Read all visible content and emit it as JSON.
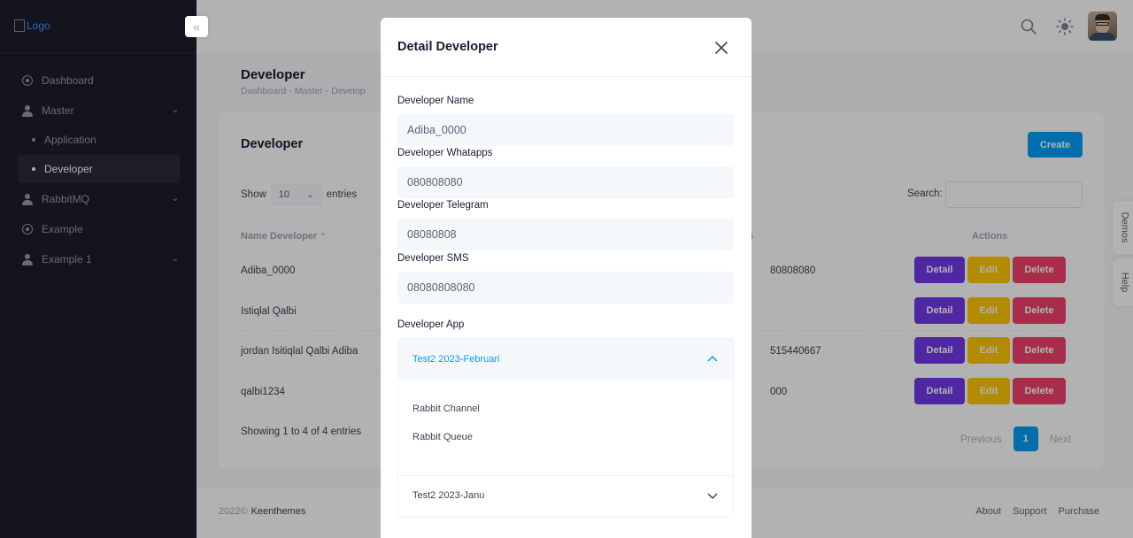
{
  "sidebar": {
    "logo_alt": "Logo",
    "items": [
      {
        "label": "Dashboard",
        "icon": "circle-dot-icon"
      },
      {
        "label": "Master",
        "icon": "user-icon"
      },
      {
        "label": "Application"
      },
      {
        "label": "Developer",
        "active": true
      },
      {
        "label": "RabbitMQ",
        "icon": "user-icon"
      },
      {
        "label": "Example",
        "icon": "circle-dot-icon"
      },
      {
        "label": "Example 1",
        "icon": "user-icon"
      }
    ]
  },
  "page": {
    "title": "Developer",
    "breadcrumb": "Dashboard - Master - Develop"
  },
  "card": {
    "title": "Developer",
    "create_label": "Create",
    "show_label": "Show",
    "page_size": "10",
    "entries_label": "entries",
    "search_label": "Search:",
    "columns": {
      "name": "Name Developer",
      "col3": "s",
      "actions": "Actions"
    },
    "rows": [
      {
        "name": "Adiba_0000",
        "col3": "80808080"
      },
      {
        "name": "Istiqlal Qalbi",
        "col3": ""
      },
      {
        "name": "jordan Isitiqlal Qalbi Adiba",
        "col3": "515440667"
      },
      {
        "name": "qalbi1234",
        "col3": "000"
      }
    ],
    "actions": {
      "detail": "Detail",
      "edit": "Edit",
      "delete": "Delete"
    },
    "showing": "Showing 1 to 4 of 4 entries",
    "pager": {
      "previous": "Previous",
      "page": "1",
      "next": "Next"
    }
  },
  "footer": {
    "year": "2022©",
    "brand": "Keenthemes",
    "links": [
      "About",
      "Support",
      "Purchase"
    ]
  },
  "side_tabs": [
    "Demos",
    "Help"
  ],
  "modal": {
    "title": "Detail Developer",
    "fields": [
      {
        "label": "Developer Name",
        "value": "Adiba_0000"
      },
      {
        "label": "Developer Whatapps",
        "value": "080808080"
      },
      {
        "label": "Developer Telegram",
        "value": "08080808"
      },
      {
        "label": "Developer SMS",
        "value": "08080808080"
      }
    ],
    "app_label": "Developer App",
    "apps": [
      {
        "name": "Test2 2023-Februari",
        "expanded": true,
        "items": [
          "Rabbit Channel",
          "Rabbit Queue"
        ]
      },
      {
        "name": "Test2 2023-Janu",
        "expanded": false
      }
    ]
  },
  "colors": {
    "primary": "#009ef7",
    "detail": "#7239ea",
    "edit": "#ffc700",
    "delete": "#f1416c",
    "sidebar": "#1e1e2d"
  }
}
